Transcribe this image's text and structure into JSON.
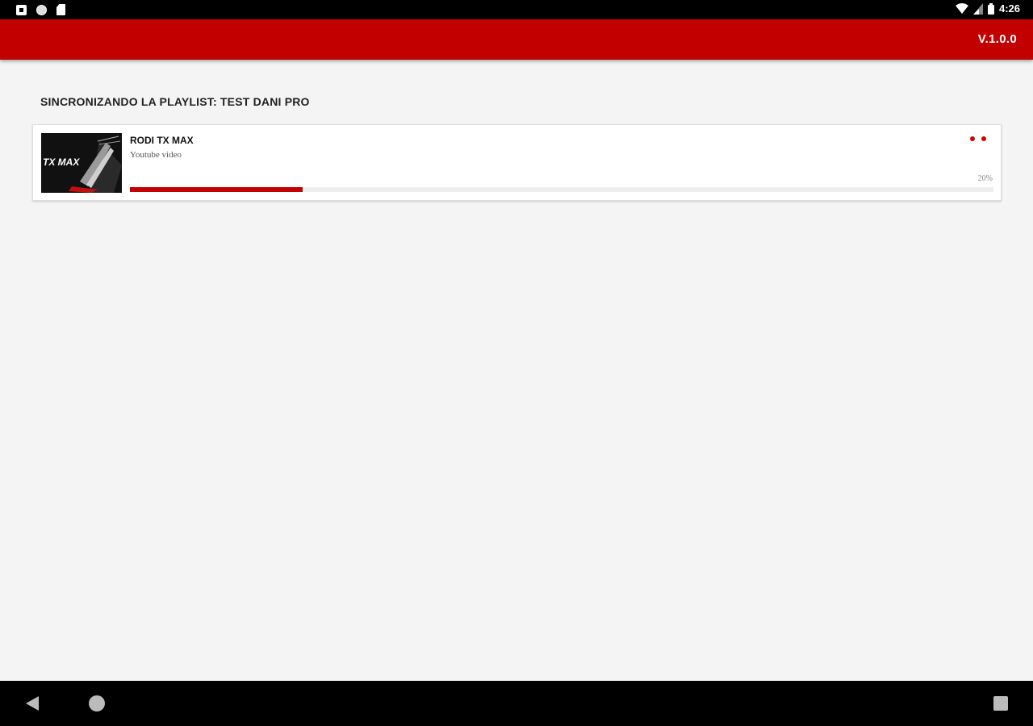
{
  "status_bar": {
    "time": "4:26",
    "left_icons": [
      "notification-icon",
      "sync-icon",
      "sd-card-icon"
    ],
    "right_icons": [
      "wifi-icon",
      "signal-icon",
      "battery-icon"
    ]
  },
  "app_bar": {
    "version": "V.1.0.0",
    "color": "#c20000"
  },
  "main": {
    "section_title": "Sincronizando la playlist: Test Dani Pro",
    "items": [
      {
        "title": "Rodi TX Max",
        "subtitle": "Youtube video",
        "progress_label": "20%",
        "progress_fraction": 0.2,
        "thumbnail_text": "TX MAX"
      }
    ]
  },
  "nav_bar": {
    "buttons": [
      "back-icon",
      "home-icon",
      "recents-icon"
    ]
  }
}
